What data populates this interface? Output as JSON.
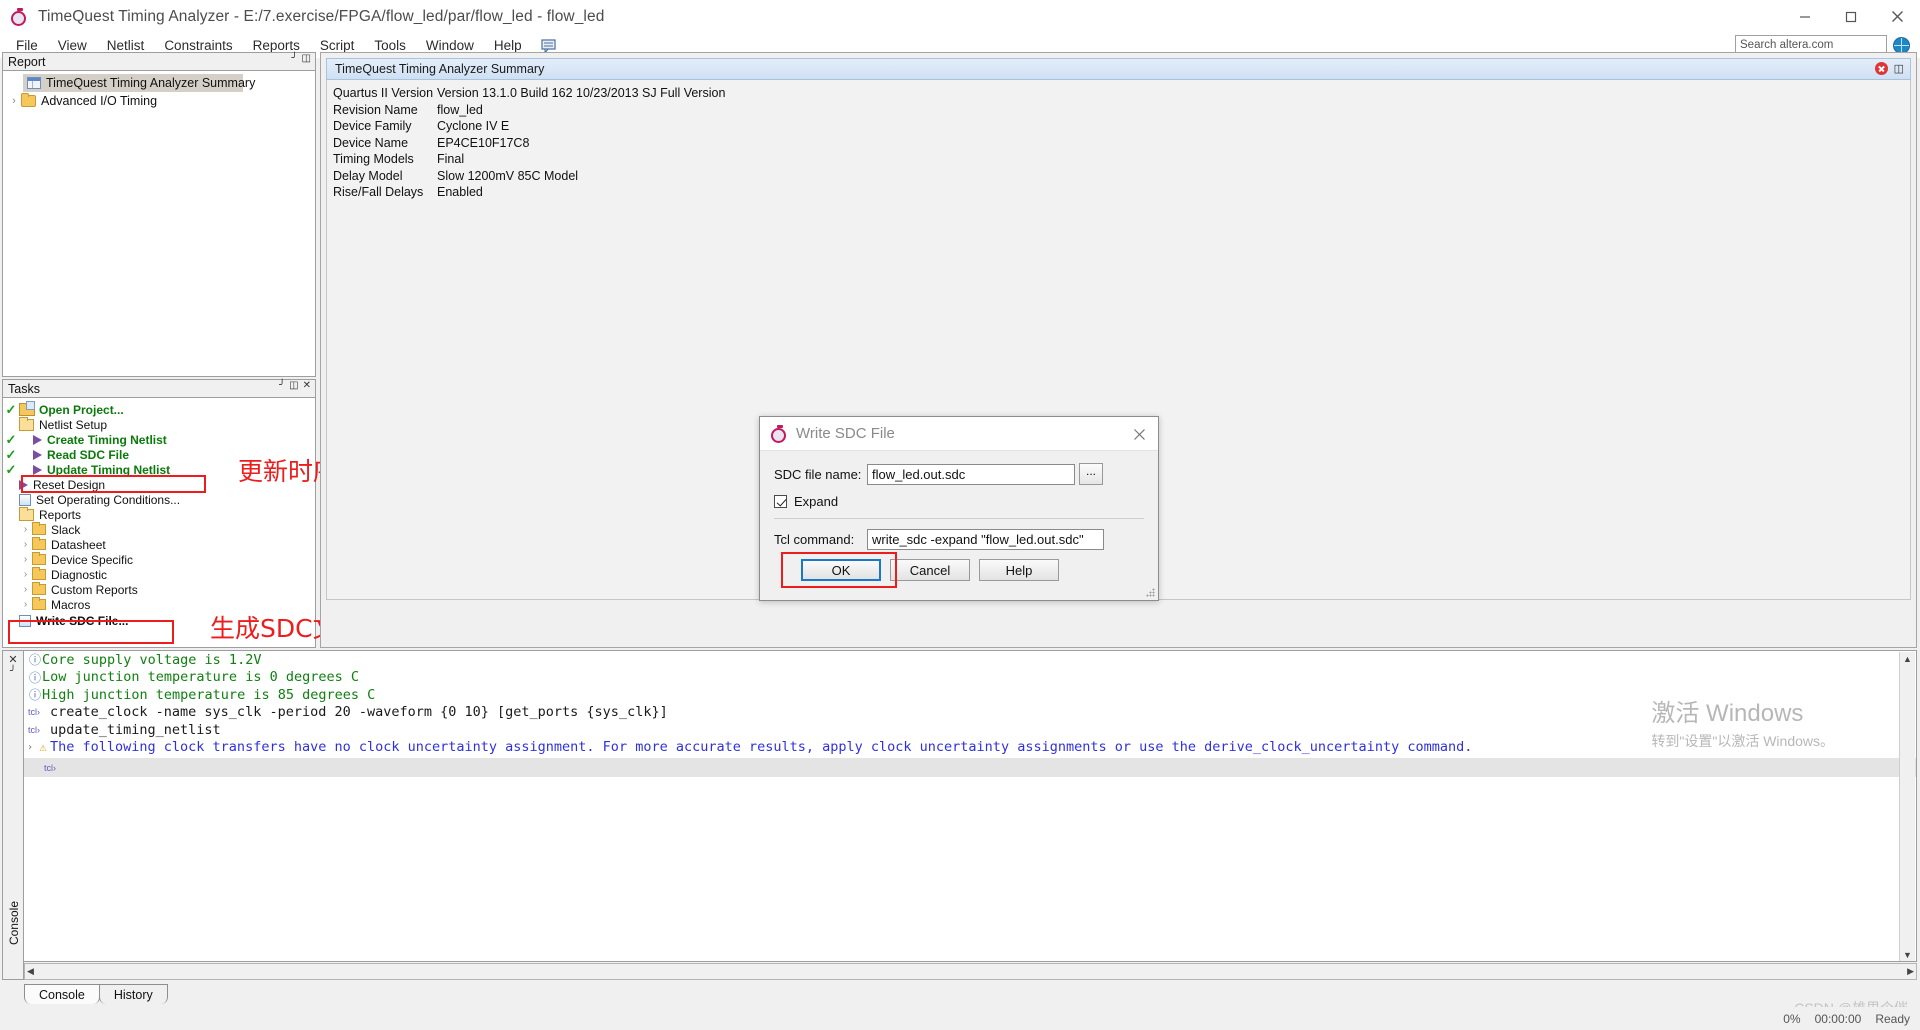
{
  "window": {
    "title": "TimeQuest Timing Analyzer - E:/7.exercise/FPGA/flow_led/par/flow_led - flow_led",
    "app_icon": "stopwatch-icon",
    "minimize": "–",
    "maximize": "□",
    "close": "✕"
  },
  "menubar": {
    "items": [
      {
        "label": "File"
      },
      {
        "label": "View"
      },
      {
        "label": "Netlist"
      },
      {
        "label": "Constraints"
      },
      {
        "label": "Reports"
      },
      {
        "label": "Script"
      },
      {
        "label": "Tools"
      },
      {
        "label": "Window"
      },
      {
        "label": "Help"
      }
    ],
    "note_icon": "note-icon",
    "search_placeholder": "Search altera.com",
    "globe_icon": "globe-icon"
  },
  "report_panel": {
    "title": "Report",
    "pin_icon": "pin-icon",
    "restore_icon": "restore-icon",
    "items": [
      {
        "label": "TimeQuest Timing Analyzer Summary",
        "icon": "table-icon",
        "selected": true,
        "chevron": ""
      },
      {
        "label": "Advanced I/O Timing",
        "icon": "folder-icon",
        "selected": false,
        "chevron": "›"
      }
    ]
  },
  "tasks_panel": {
    "title": "Tasks",
    "pin_icon": "pin-icon",
    "restore_icon": "restore-icon",
    "close_icon": "close-icon",
    "items": [
      {
        "label": "Open Project...",
        "check": true,
        "icon": "project-folder-icon",
        "style": "bold-green",
        "indent": 0,
        "chevron": ""
      },
      {
        "label": "Netlist Setup",
        "check": false,
        "icon": "folder-open-icon",
        "style": "plain",
        "indent": 0,
        "chevron": ""
      },
      {
        "label": "Create Timing Netlist",
        "check": true,
        "icon": "play-icon",
        "style": "bold-green",
        "indent": 1,
        "chevron": ""
      },
      {
        "label": "Read SDC File",
        "check": true,
        "icon": "play-icon",
        "style": "bold-green",
        "indent": 1,
        "chevron": ""
      },
      {
        "label": "Update Timing Netlist",
        "check": true,
        "icon": "play-icon",
        "style": "bold-green",
        "indent": 1,
        "chevron": ""
      },
      {
        "label": "Reset Design",
        "check": false,
        "icon": "play-icon",
        "style": "plain",
        "indent": 0,
        "chevron": ""
      },
      {
        "label": "Set Operating Conditions...",
        "check": false,
        "icon": "doc-icon",
        "style": "plain",
        "indent": 0,
        "chevron": ""
      },
      {
        "label": "Reports",
        "check": false,
        "icon": "folder-open-icon",
        "style": "plain",
        "indent": 0,
        "chevron": ""
      },
      {
        "label": "Slack",
        "check": false,
        "icon": "folder-icon",
        "style": "plain",
        "indent": 1,
        "chevron": "›"
      },
      {
        "label": "Datasheet",
        "check": false,
        "icon": "folder-icon",
        "style": "plain",
        "indent": 1,
        "chevron": "›"
      },
      {
        "label": "Device Specific",
        "check": false,
        "icon": "folder-icon",
        "style": "plain",
        "indent": 1,
        "chevron": "›"
      },
      {
        "label": "Diagnostic",
        "check": false,
        "icon": "folder-icon",
        "style": "plain",
        "indent": 1,
        "chevron": "›"
      },
      {
        "label": "Custom Reports",
        "check": false,
        "icon": "folder-icon",
        "style": "plain",
        "indent": 1,
        "chevron": "›"
      },
      {
        "label": "Macros",
        "check": false,
        "icon": "folder-icon",
        "style": "plain",
        "indent": 1,
        "chevron": "›"
      },
      {
        "label": "Write SDC File...",
        "check": false,
        "icon": "doc-icon",
        "style": "bold",
        "indent": 0,
        "chevron": ""
      }
    ]
  },
  "annotations": [
    {
      "text": "更新时序约束",
      "color": "#ee1d1d"
    },
    {
      "text": "生成SDC文件",
      "color": "#ee1d1d"
    }
  ],
  "main": {
    "doc_title": "TimeQuest Timing Analyzer Summary",
    "close_icon": "close-doc-icon",
    "restore_icon": "restore-doc-icon",
    "summary_rows": [
      {
        "key": "Quartus II Version",
        "value": "Version 13.1.0 Build 162 10/23/2013 SJ Full Version"
      },
      {
        "key": "Revision Name",
        "value": "flow_led"
      },
      {
        "key": "Device Family",
        "value": "Cyclone IV E"
      },
      {
        "key": "Device Name",
        "value": "EP4CE10F17C8"
      },
      {
        "key": "Timing Models",
        "value": "Final"
      },
      {
        "key": "Delay Model",
        "value": "Slow 1200mV 85C Model"
      },
      {
        "key": "Rise/Fall Delays",
        "value": "Enabled"
      }
    ]
  },
  "dialog": {
    "title": "Write SDC File",
    "icon": "stopwatch-icon",
    "close_icon": "close-icon",
    "file_label": "SDC file name:",
    "file_value": "flow_led.out.sdc",
    "browse_label": "...",
    "expand_label": "Expand",
    "expand_checked": true,
    "tcl_label": "Tcl command:",
    "tcl_value": "write_sdc -expand \"flow_led.out.sdc\"",
    "ok_label": "OK",
    "cancel_label": "Cancel",
    "help_label": "Help"
  },
  "console": {
    "vertical_label": "Console",
    "close_icon": "close-icon",
    "pin_icon": "pin-icon",
    "lines": [
      {
        "type": "info",
        "marker": "ⓘ",
        "text": "Core supply voltage is 1.2V"
      },
      {
        "type": "info",
        "marker": "ⓘ",
        "text": "Low junction temperature is 0 degrees C"
      },
      {
        "type": "info",
        "marker": "ⓘ",
        "text": "High junction temperature is 85 degrees C"
      },
      {
        "type": "tcl",
        "marker": "tcl›",
        "text": "create_clock -name sys_clk -period 20 -waveform {0 10} [get_ports {sys_clk}]"
      },
      {
        "type": "tcl",
        "marker": "tcl›",
        "text": "update_timing_netlist"
      },
      {
        "type": "warn",
        "marker": "⚠",
        "text": "The following clock transfers have no clock uncertainty assignment. For more accurate results, apply clock uncertainty assignments or use the derive_clock_uncertainty command."
      }
    ],
    "prompt": "tcl›",
    "tabs": [
      {
        "label": "Console",
        "active": true
      },
      {
        "label": "History",
        "active": false
      }
    ]
  },
  "watermark": {
    "line1": "激活 Windows",
    "line2": "转到\"设置\"以激活 Windows。",
    "csdn": "CSDN @雄里个催"
  },
  "statusbar": {
    "progress": "0%",
    "time": "00:00:00",
    "state": "Ready"
  }
}
